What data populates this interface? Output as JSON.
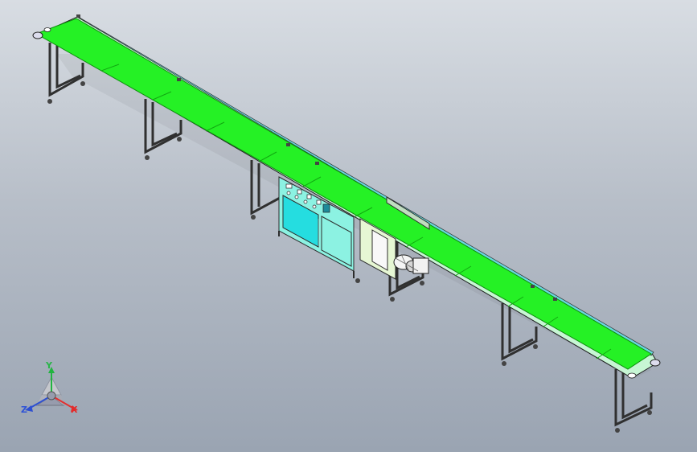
{
  "triad": {
    "x_label": "X",
    "y_label": "Y",
    "z_label": "Z"
  },
  "colors": {
    "belt": "#25f125",
    "belt_edge": "#13a413",
    "rail": "#67d8dd",
    "frame": "#3b3b3b",
    "cabinet": "#8cf2e2",
    "cabinet_panel": "#25dde0",
    "background_top": "#d8dde3",
    "background_bottom": "#9aa4b2"
  },
  "icons": {
    "triad": "coordinate-triad-icon"
  }
}
